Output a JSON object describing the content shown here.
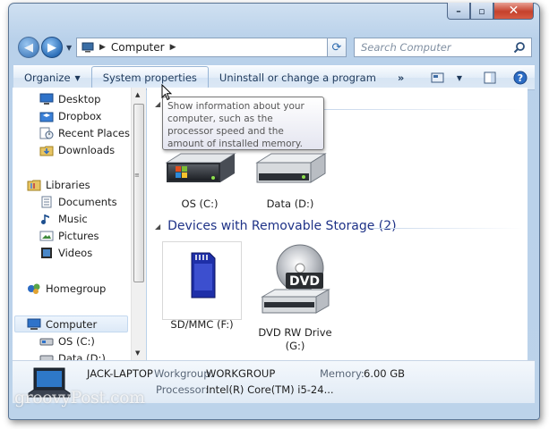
{
  "navigation": {
    "address_crumb": "Computer",
    "search_placeholder": "Search Computer"
  },
  "toolbar": {
    "organize": "Organize",
    "system_properties": "System properties",
    "uninstall": "Uninstall or change a program",
    "more": "»"
  },
  "sidebar": {
    "items": [
      {
        "label": "Desktop",
        "icon": "desktop-icon"
      },
      {
        "label": "Dropbox",
        "icon": "dropbox-icon"
      },
      {
        "label": "Recent Places",
        "icon": "recent-places-icon"
      },
      {
        "label": "Downloads",
        "icon": "downloads-icon"
      },
      {
        "label": "Libraries",
        "icon": "libraries-icon"
      },
      {
        "label": "Documents",
        "icon": "documents-icon"
      },
      {
        "label": "Music",
        "icon": "music-icon"
      },
      {
        "label": "Pictures",
        "icon": "pictures-icon"
      },
      {
        "label": "Videos",
        "icon": "videos-icon"
      },
      {
        "label": "Homegroup",
        "icon": "homegroup-icon"
      },
      {
        "label": "Computer",
        "icon": "computer-icon"
      },
      {
        "label": "OS (C:)",
        "icon": "drive-icon"
      },
      {
        "label": "Data (D:)",
        "icon": "drive-icon"
      }
    ]
  },
  "tooltip": {
    "text": "Show information about your computer, such as the processor speed and the amount of installed memory."
  },
  "content": {
    "hard_drives": [
      {
        "label": "OS (C:)"
      },
      {
        "label": "Data (D:)"
      }
    ],
    "removable_group_title": "Devices with Removable Storage (2)",
    "removable": [
      {
        "label": "SD/MMC (F:)"
      },
      {
        "label_line1": "DVD RW Drive",
        "label_line2": "(G:)"
      }
    ],
    "dvd_text": "DVD"
  },
  "details": {
    "computer_name": "JACK-LAPTOP",
    "workgroup_label": "Workgroup:",
    "workgroup_value": "WORKGROUP",
    "memory_label": "Memory:",
    "memory_value": "6.00 GB",
    "processor_label": "Processor:",
    "processor_value": "Intel(R) Core(TM) i5-24..."
  },
  "watermark": "groovyPost.com",
  "colors": {
    "group_heading": "#1e3287",
    "toolbar_text": "#1e395b",
    "window_frame": "#b9d1ea"
  }
}
